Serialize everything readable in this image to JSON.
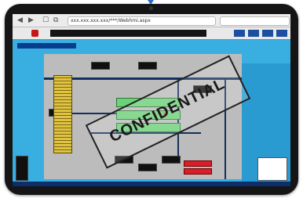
{
  "browser": {
    "back_label": "◀",
    "forward_label": "▶",
    "bookmarks_label": "☐",
    "url": "xxx.xxx.xxx.xxx/***/Webhmi.aspx",
    "search_placeholder": ""
  },
  "app": {
    "ticker_text": "",
    "plant_title": "",
    "watermark": "CONFIDENTIAL"
  }
}
